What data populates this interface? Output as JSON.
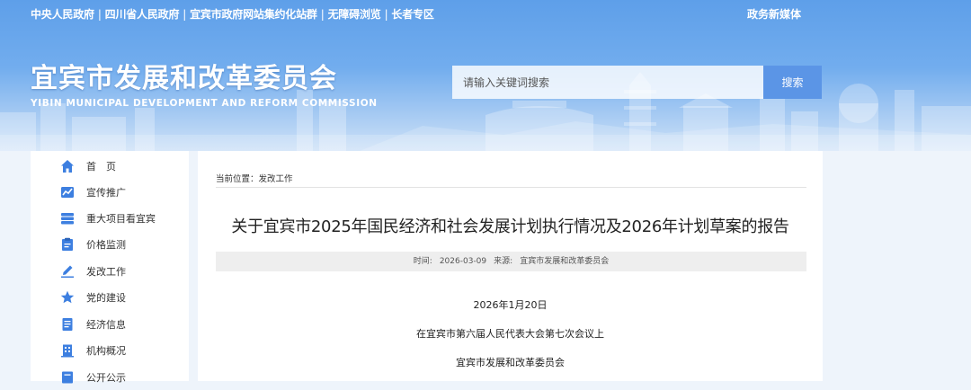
{
  "top_links": [
    "中央人民政府",
    "四川省人民政府",
    "宜宾市政府网站集约化站群",
    "无障碍浏览",
    "长者专区"
  ],
  "top_right_link": "政务新媒体",
  "site": {
    "title": "宜宾市发展和改革委员会",
    "subtitle": "YIBIN MUNICIPAL DEVELOPMENT AND REFORM COMMISSION"
  },
  "search": {
    "placeholder": "请输入关键词搜索",
    "button_label": "搜索"
  },
  "sidebar": {
    "items": [
      {
        "label": "首　页",
        "icon": "home-icon"
      },
      {
        "label": "宣传推广",
        "icon": "chart-icon"
      },
      {
        "label": "重大项目看宜宾",
        "icon": "stack-icon"
      },
      {
        "label": "价格监测",
        "icon": "clipboard-icon"
      },
      {
        "label": "发改工作",
        "icon": "edit-icon"
      },
      {
        "label": "党的建设",
        "icon": "star-icon"
      },
      {
        "label": "经济信息",
        "icon": "document-icon"
      },
      {
        "label": "机构概况",
        "icon": "building-icon"
      },
      {
        "label": "公开公示",
        "icon": "notice-icon"
      }
    ]
  },
  "breadcrumb": {
    "prefix": "当前位置：",
    "current": "发改工作"
  },
  "article": {
    "title": "关于宜宾市2025年国民经济和社会发展计划执行情况及2026年计划草案的报告",
    "time_label": "时间:",
    "time": "2026-03-09",
    "source_label": "来源:",
    "source": "宜宾市发展和改革委员会",
    "paragraphs": [
      "2026年1月20日",
      "在宜宾市第六届人民代表大会第七次会议上",
      "宜宾市发展和改革委员会"
    ]
  },
  "colors": {
    "banner_top": "#5e9fe9",
    "search_button": "#5b95e6",
    "nav_icon": "#3d7fe0",
    "page_background": "#eef4fb"
  }
}
